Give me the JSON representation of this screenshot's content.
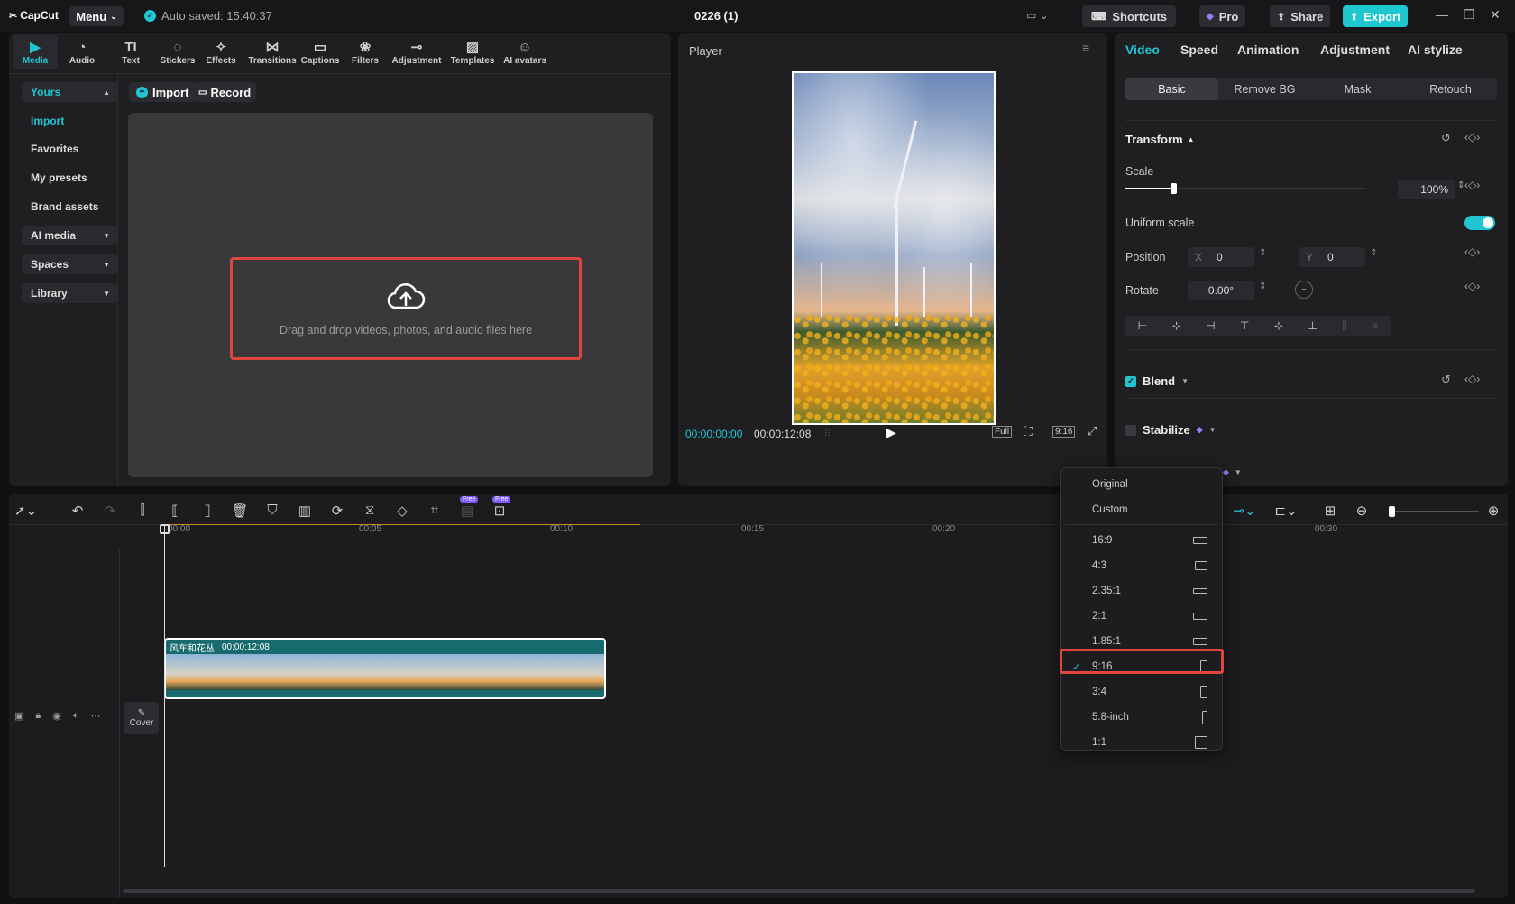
{
  "app": {
    "logo": "CapCut",
    "menu_label": "Menu",
    "autosave": "Auto saved: 15:40:37",
    "project_title": "0226 (1)",
    "shortcuts": "Shortcuts",
    "pro": "Pro",
    "share": "Share",
    "export": "Export",
    "accent": "#20c5d1",
    "export_color": "#1fc8d1"
  },
  "media": {
    "tabs": [
      {
        "label": "Media",
        "icon": "media-icon"
      },
      {
        "label": "Audio",
        "icon": "audio-icon"
      },
      {
        "label": "Text",
        "icon": "text-icon"
      },
      {
        "label": "Stickers",
        "icon": "stickers-icon"
      },
      {
        "label": "Effects",
        "icon": "effects-icon"
      },
      {
        "label": "Transitions",
        "icon": "transitions-icon"
      },
      {
        "label": "Captions",
        "icon": "captions-icon"
      },
      {
        "label": "Filters",
        "icon": "filters-icon"
      },
      {
        "label": "Adjustment",
        "icon": "adjustment-icon"
      },
      {
        "label": "Templates",
        "icon": "templates-icon"
      },
      {
        "label": "AI avatars",
        "icon": "ai-avatars-icon"
      }
    ],
    "sidebar": {
      "yours": "Yours",
      "import": "Import",
      "favorites": "Favorites",
      "my_presets": "My presets",
      "brand_assets": "Brand assets",
      "ai_media": "AI media",
      "spaces": "Spaces",
      "library": "Library"
    },
    "import_btn": "Import",
    "record_btn": "Record",
    "drop_text": "Drag and drop videos, photos, and audio files here"
  },
  "player": {
    "title": "Player",
    "current_time": "00:00:00:00",
    "total_time": "00:00:12:08",
    "full_label": "Full",
    "ratio_label": "9:16"
  },
  "props": {
    "tabs": [
      "Video",
      "Speed",
      "Animation",
      "Adjustment",
      "AI stylize"
    ],
    "subtabs": [
      "Basic",
      "Remove BG",
      "Mask",
      "Retouch"
    ],
    "transform": "Transform",
    "scale_label": "Scale",
    "scale_value": "100%",
    "scale_level": 0.2,
    "uniform_scale": "Uniform scale",
    "position_label": "Position",
    "pos_x_label": "X",
    "pos_x": "0",
    "pos_y_label": "Y",
    "pos_y": "0",
    "rotate_label": "Rotate",
    "rotate_value": "0.00°",
    "blend": "Blend",
    "stabilize": "Stabilize"
  },
  "timeline": {
    "ruler": [
      "00:00",
      "00:05",
      "00:10",
      "00:15",
      "00:20",
      "00:30"
    ],
    "clip_name": "风车和花丛",
    "clip_duration": "00:00:12:08",
    "cover_label": "Cover",
    "free_badge": "Free"
  },
  "ratio_dropdown": {
    "items": [
      {
        "label": "Original",
        "icon": ""
      },
      {
        "label": "Custom",
        "icon": ""
      },
      {
        "label": "16:9",
        "icon": "wide"
      },
      {
        "label": "4:3",
        "icon": "standard"
      },
      {
        "label": "2.35:1",
        "icon": "cinema"
      },
      {
        "label": "2:1",
        "icon": "wide"
      },
      {
        "label": "1.85:1",
        "icon": "wide"
      },
      {
        "label": "9:16",
        "icon": "portrait",
        "selected": true
      },
      {
        "label": "3:4",
        "icon": "portrait"
      },
      {
        "label": "5.8-inch",
        "icon": "tall"
      },
      {
        "label": "1:1",
        "icon": "square"
      }
    ]
  }
}
